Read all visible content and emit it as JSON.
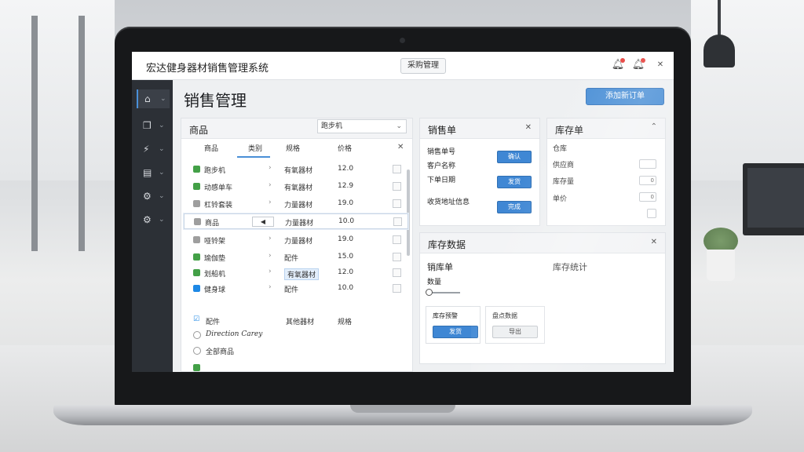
{
  "app": {
    "title": "宏达健身器材销售管理系统"
  },
  "topbar": {
    "button_label": "采购管理"
  },
  "page": {
    "title": "销售管理",
    "primary_button": "添加新订单"
  },
  "sidebar": {
    "items": [
      {
        "icon": "home-icon",
        "glyph": "⌂"
      },
      {
        "icon": "box-icon",
        "glyph": "❒"
      },
      {
        "icon": "chart-icon",
        "glyph": "⚡"
      },
      {
        "icon": "document-icon",
        "glyph": "▤"
      },
      {
        "icon": "gear-icon",
        "glyph": "⚙"
      },
      {
        "icon": "settings-icon",
        "glyph": "⚙"
      }
    ]
  },
  "products": {
    "title": "商品",
    "filter_value": "跑步机",
    "columns": [
      "商品",
      "类别",
      "规格",
      "价格"
    ],
    "rows": [
      {
        "name": "跑步机",
        "category": "有氧器材",
        "price": "12.0",
        "checkbox_color": "#43a047"
      },
      {
        "name": "动感单车",
        "category": "有氧器材",
        "price": "12.9",
        "checkbox_color": "#43a047"
      },
      {
        "name": "杠铃套装",
        "category": "力量器材",
        "price": "19.0",
        "checkbox_color": "#9e9e9e"
      },
      {
        "name": "商品",
        "category": "力量器材",
        "price": "10.0",
        "checkbox_color": "#9e9e9e",
        "input_value": "◀"
      },
      {
        "name": "哑铃架",
        "category": "力量器材",
        "price": "19.0",
        "checkbox_color": "#9e9e9e"
      },
      {
        "name": "瑜伽垫",
        "category": "配件",
        "price": "15.0",
        "checkbox_color": "#43a047"
      },
      {
        "name": "划船机",
        "category": "有氧器材",
        "price": "12.0",
        "checkbox_color": "#43a047"
      },
      {
        "name": "健身球",
        "category": "配件",
        "price": "10.0",
        "checkbox_color": "#1e88e5"
      }
    ],
    "bottom": [
      {
        "name": "配件",
        "category": "其他器材",
        "price": "规格"
      },
      {
        "name": "Direction Carey"
      },
      {
        "name": "全部商品"
      }
    ]
  },
  "sales_order": {
    "title": "销售单",
    "labels": [
      "销售单号",
      "客户名称",
      "下单日期",
      "收货地址信息"
    ],
    "buttons": [
      "确认",
      "发货",
      "完成"
    ]
  },
  "stock_order": {
    "title": "库存单",
    "labels": [
      "仓库",
      "供应商",
      "库存量",
      "单价"
    ],
    "field_values": [
      "",
      "0",
      "0",
      ""
    ]
  },
  "inventory": {
    "title": "库存数据",
    "left_label": "销库单",
    "right_label": "库存统计",
    "sub_label": "数量",
    "cards": [
      {
        "title": "库存预警",
        "button": "发货"
      },
      {
        "title": "盘点数据",
        "button": "导出"
      }
    ]
  }
}
